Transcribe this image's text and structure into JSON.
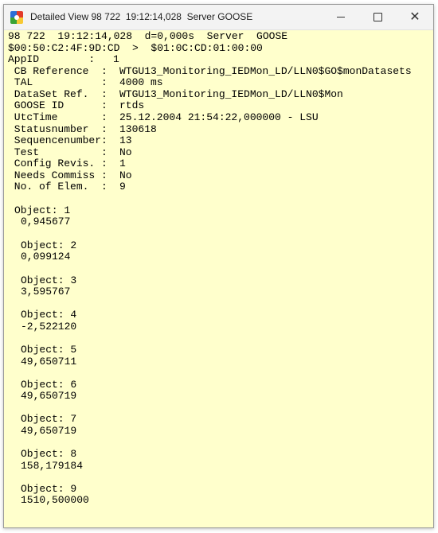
{
  "window": {
    "title": "Detailed View 98 722  19:12:14,028  Server GOOSE",
    "icon": "app-icon"
  },
  "header": {
    "line1": "98 722  19:12:14,028  d=0,000s  Server  GOOSE",
    "line2": "$00:50:C2:4F:9D:CD  >  $01:0C:CD:01:00:00"
  },
  "fields": [
    {
      "label": "AppID        :",
      "value": "1"
    },
    {
      "label": " CB Reference  :",
      "value": "WTGU13_Monitoring_IEDMon_LD/LLN0$GO$monDatasets"
    },
    {
      "label": " TAL           :",
      "value": "4000 ms"
    },
    {
      "label": " DataSet Ref.  :",
      "value": "WTGU13_Monitoring_IEDMon_LD/LLN0$Mon"
    },
    {
      "label": " GOOSE ID      :",
      "value": "rtds"
    },
    {
      "label": " UtcTime       :",
      "value": "25.12.2004 21:54:22,000000 - LSU"
    },
    {
      "label": " Statusnumber  :",
      "value": "130618"
    },
    {
      "label": " Sequencenumber:",
      "value": "13"
    },
    {
      "label": " Test          :",
      "value": "No"
    },
    {
      "label": " Config Revis. :",
      "value": "1"
    },
    {
      "label": " Needs Commiss :",
      "value": "No"
    },
    {
      "label": " No. of Elem.  :",
      "value": "9"
    }
  ],
  "objects": [
    {
      "label": "Object: 1",
      "value": "0,945677"
    },
    {
      "label": "Object: 2",
      "value": "0,099124"
    },
    {
      "label": "Object: 3",
      "value": "3,595767"
    },
    {
      "label": "Object: 4",
      "value": "-2,522120"
    },
    {
      "label": "Object: 5",
      "value": "49,650711"
    },
    {
      "label": "Object: 6",
      "value": "49,650719"
    },
    {
      "label": "Object: 7",
      "value": "49,650719"
    },
    {
      "label": "Object: 8",
      "value": "158,179184"
    },
    {
      "label": "Object: 9",
      "value": "1510,500000"
    }
  ]
}
